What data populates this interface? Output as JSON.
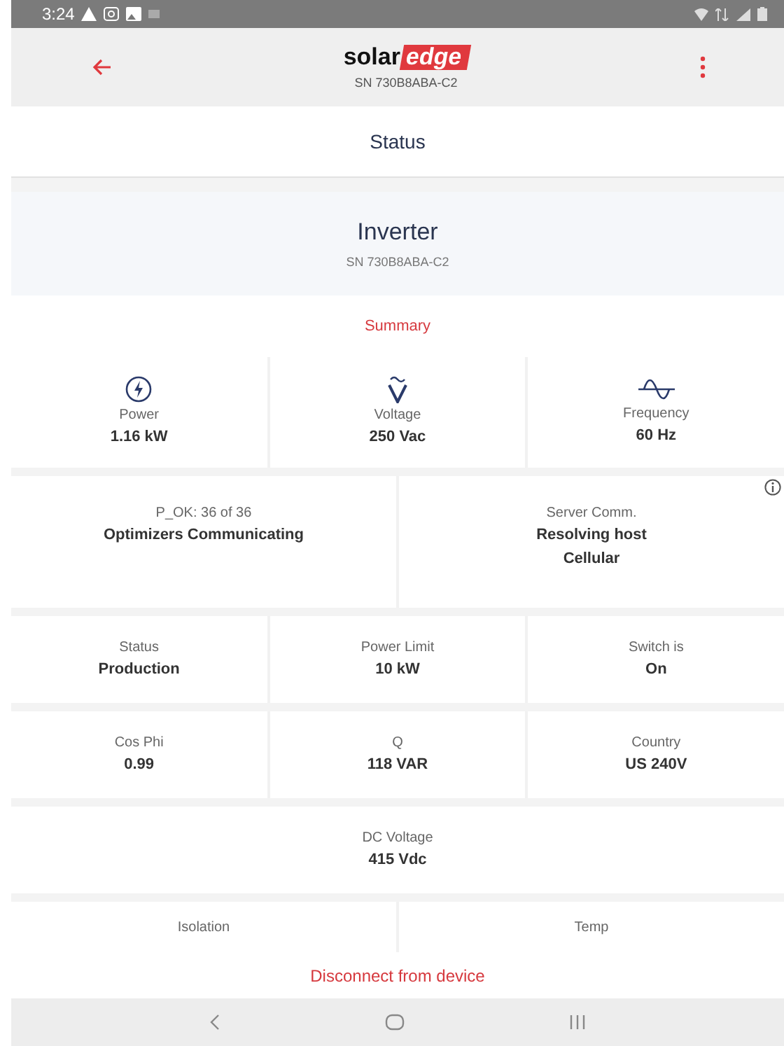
{
  "status_bar": {
    "time": "3:24"
  },
  "header": {
    "logo": {
      "dark": "solar",
      "light": "edge"
    },
    "serial": "SN 730B8ABA-C2"
  },
  "page_title": "Status",
  "device": {
    "name": "Inverter",
    "serial": "SN 730B8ABA-C2"
  },
  "section_title": "Summary",
  "sections": [
    {
      "info": false,
      "cells": [
        {
          "kind": "power",
          "label": "Power",
          "values": [
            "1.16 kW"
          ]
        },
        {
          "kind": "voltage",
          "label": "Voltage",
          "values": [
            "250 Vac"
          ]
        },
        {
          "kind": "frequency",
          "label": "Frequency",
          "values": [
            "60 Hz"
          ]
        }
      ]
    },
    {
      "info": true,
      "cells": [
        {
          "label": "P_OK: 36 of 36",
          "values": [
            "Optimizers Communicating"
          ]
        },
        {
          "label": "Server Comm.",
          "values": [
            "Resolving host",
            "Cellular"
          ]
        }
      ]
    },
    {
      "info": false,
      "cells": [
        {
          "label": "Status",
          "values": [
            "Production"
          ]
        },
        {
          "label": "Power Limit",
          "values": [
            "10 kW"
          ]
        },
        {
          "label": "Switch is",
          "values": [
            "On"
          ]
        }
      ]
    },
    {
      "info": false,
      "cells": [
        {
          "label": "Cos Phi",
          "values": [
            "0.99"
          ]
        },
        {
          "label": "Q",
          "values": [
            "118 VAR"
          ]
        },
        {
          "label": "Country",
          "values": [
            "US 240V"
          ]
        }
      ]
    },
    {
      "info": false,
      "cells": [
        {
          "label": "DC Voltage",
          "values": [
            "415 Vdc"
          ]
        }
      ]
    },
    {
      "info": false,
      "cells": [
        {
          "label": "Isolation"
        },
        {
          "label": "Temp"
        }
      ]
    }
  ],
  "footer_action": "Disconnect from device"
}
